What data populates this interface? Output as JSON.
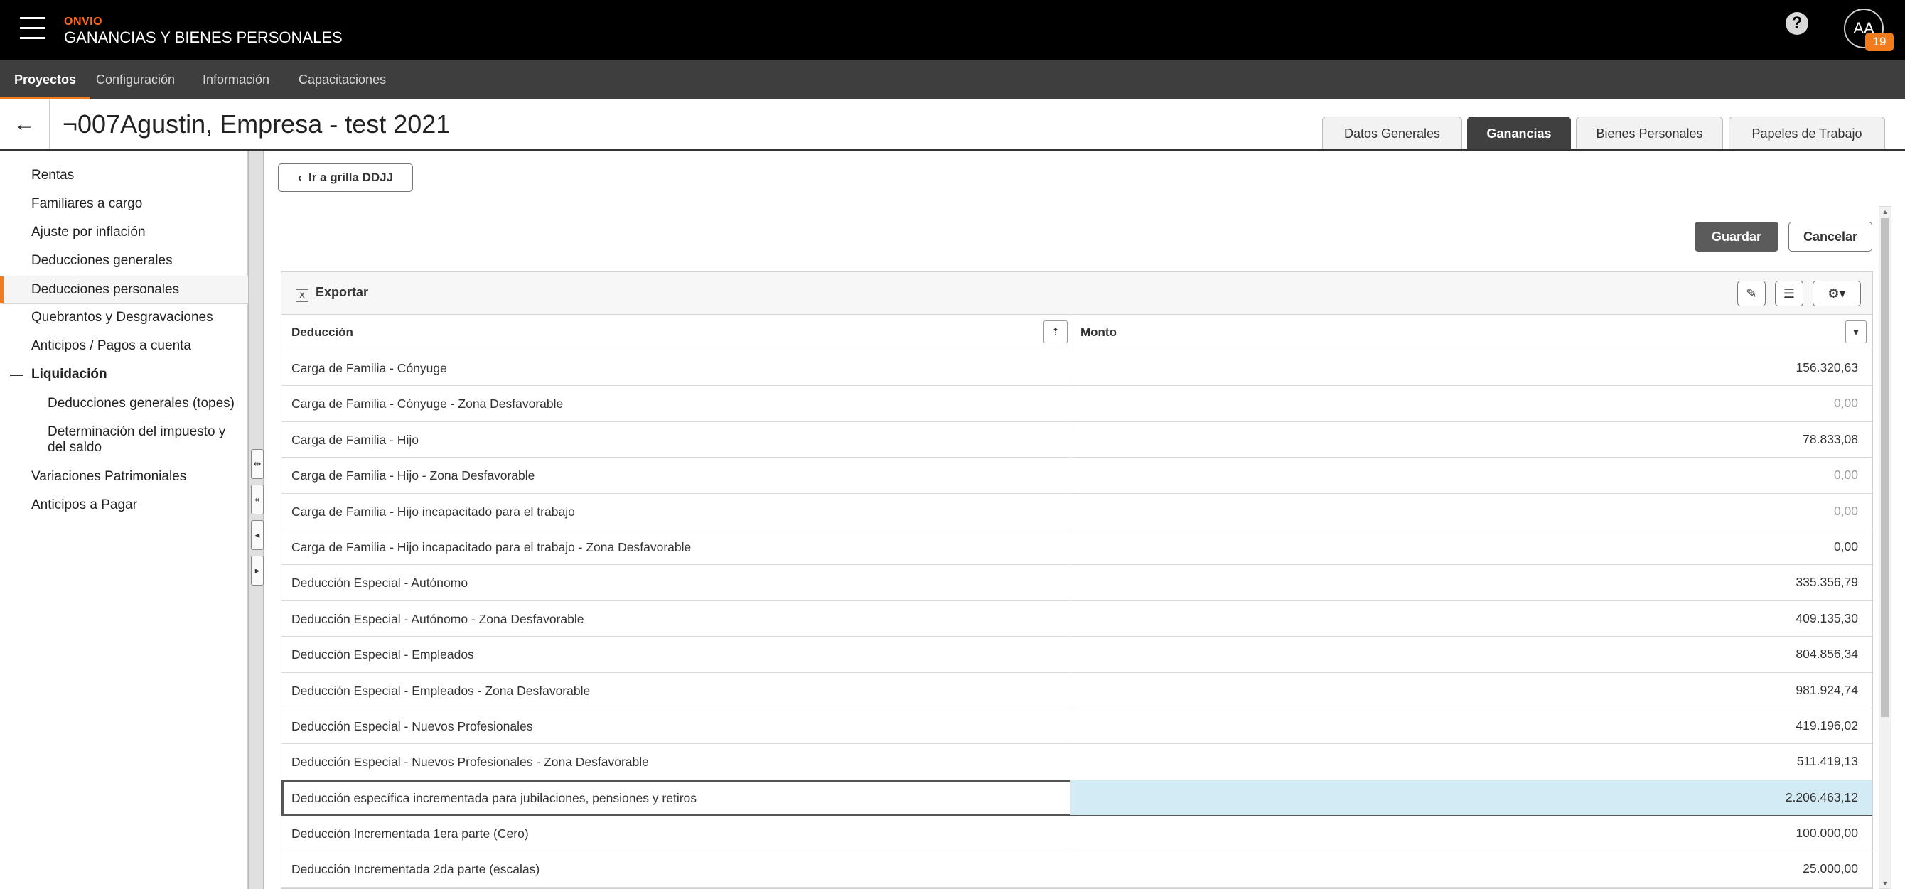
{
  "app": {
    "brand_top": "ONVIO",
    "brand_main": "GANANCIAS Y BIENES PERSONALES",
    "help_icon": "?",
    "avatar_initials": "AA",
    "notif_count": "19"
  },
  "nav": {
    "items": [
      {
        "label": "Proyectos"
      },
      {
        "label": "Configuración"
      },
      {
        "label": "Información"
      },
      {
        "label": "Capacitaciones"
      }
    ]
  },
  "titlebar": {
    "back_icon": "←",
    "title": "¬007Agustin, Empresa - test 2021",
    "tabs": [
      {
        "label": "Datos Generales"
      },
      {
        "label": "Ganancias"
      },
      {
        "label": "Bienes Personales"
      },
      {
        "label": "Papeles de Trabajo"
      }
    ]
  },
  "sidebar": {
    "items": [
      {
        "label": "Rentas"
      },
      {
        "label": "Familiares a cargo"
      },
      {
        "label": "Ajuste por inflación"
      },
      {
        "label": "Deducciones generales"
      },
      {
        "label": "Deducciones personales"
      },
      {
        "label": "Quebrantos y Desgravaciones"
      },
      {
        "label": "Anticipos / Pagos a cuenta"
      },
      {
        "label": "Liquidación"
      },
      {
        "label": "Deducciones generales (topes)"
      },
      {
        "label": "Determinación del impuesto y del saldo"
      },
      {
        "label": "Variaciones Patrimoniales"
      },
      {
        "label": "Anticipos a Pagar"
      }
    ]
  },
  "main": {
    "grilla_button": "Ir a grilla DDJJ",
    "save_label": "Guardar",
    "cancel_label": "Cancelar",
    "export_label": "Exportar",
    "columns": {
      "deduccion": "Deducción",
      "monto": "Monto"
    },
    "rows": [
      {
        "deduccion": "Carga de Familia - Cónyuge",
        "monto": "156.320,63"
      },
      {
        "deduccion": "Carga de Familia - Cónyuge - Zona Desfavorable",
        "monto": "0,00"
      },
      {
        "deduccion": "Carga de Familia - Hijo",
        "monto": "78.833,08"
      },
      {
        "deduccion": "Carga de Familia - Hijo - Zona Desfavorable",
        "monto": "0,00"
      },
      {
        "deduccion": "Carga de Familia - Hijo incapacitado para el trabajo",
        "monto": "0,00"
      },
      {
        "deduccion": "Carga de Familia - Hijo incapacitado para el trabajo - Zona Desfavorable",
        "monto": "0,00"
      },
      {
        "deduccion": "Deducción Especial - Autónomo",
        "monto": "335.356,79"
      },
      {
        "deduccion": "Deducción Especial - Autónomo - Zona Desfavorable",
        "monto": "409.135,30"
      },
      {
        "deduccion": "Deducción Especial - Empleados",
        "monto": "804.856,34"
      },
      {
        "deduccion": "Deducción Especial - Empleados - Zona Desfavorable",
        "monto": "981.924,74"
      },
      {
        "deduccion": "Deducción Especial - Nuevos Profesionales",
        "monto": "419.196,02"
      },
      {
        "deduccion": "Deducción Especial - Nuevos Profesionales - Zona Desfavorable",
        "monto": "511.419,13"
      },
      {
        "deduccion": "Deducción específica incrementada para jubilaciones, pensiones y retiros",
        "monto": "2.206.463,12"
      },
      {
        "deduccion": "Deducción Incrementada 1era parte (Cero)",
        "monto": "100.000,00"
      },
      {
        "deduccion": "Deducción Incrementada 2da parte (escalas)",
        "monto": "25.000,00"
      }
    ]
  },
  "colors": {
    "accent": "#f07c1e",
    "selected_cell": "#d3ebf5",
    "navbar": "#3e3e3e"
  }
}
